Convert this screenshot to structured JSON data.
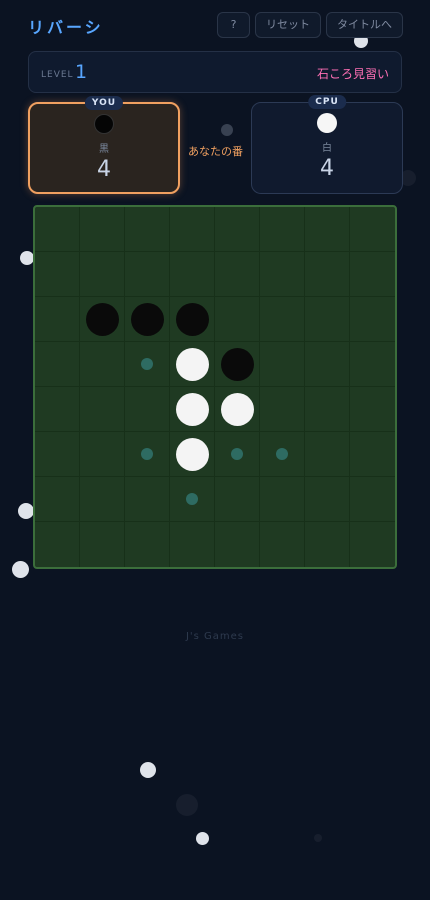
{
  "header": {
    "title": "リバーシ",
    "help_label": "?",
    "reset_label": "リセット",
    "to_title_label": "タイトルへ"
  },
  "level": {
    "label": "LEVEL",
    "number": "1",
    "name": "石ころ見習い"
  },
  "player": {
    "tag": "YOU",
    "color_name": "黒",
    "count": "4"
  },
  "cpu": {
    "tag": "CPU",
    "color_name": "白",
    "count": "4"
  },
  "turn_text": "あなたの番",
  "board": {
    "size": 8,
    "rows": [
      "........",
      "........",
      ".BBB....",
      "..hWB...",
      "...WW...",
      "..hWhh..",
      "...h....",
      "........"
    ],
    "legend": {
      "B": "black",
      "W": "white",
      "h": "valid-move"
    }
  },
  "footer": "J's Games",
  "colors": {
    "background": "#0b1322",
    "accent_blue": "#58a6ff",
    "level_name_pink": "#ff6fb5",
    "active_orange": "#f0a060",
    "board_green": "#1f3a22",
    "hint_teal": "#2e6b62"
  }
}
